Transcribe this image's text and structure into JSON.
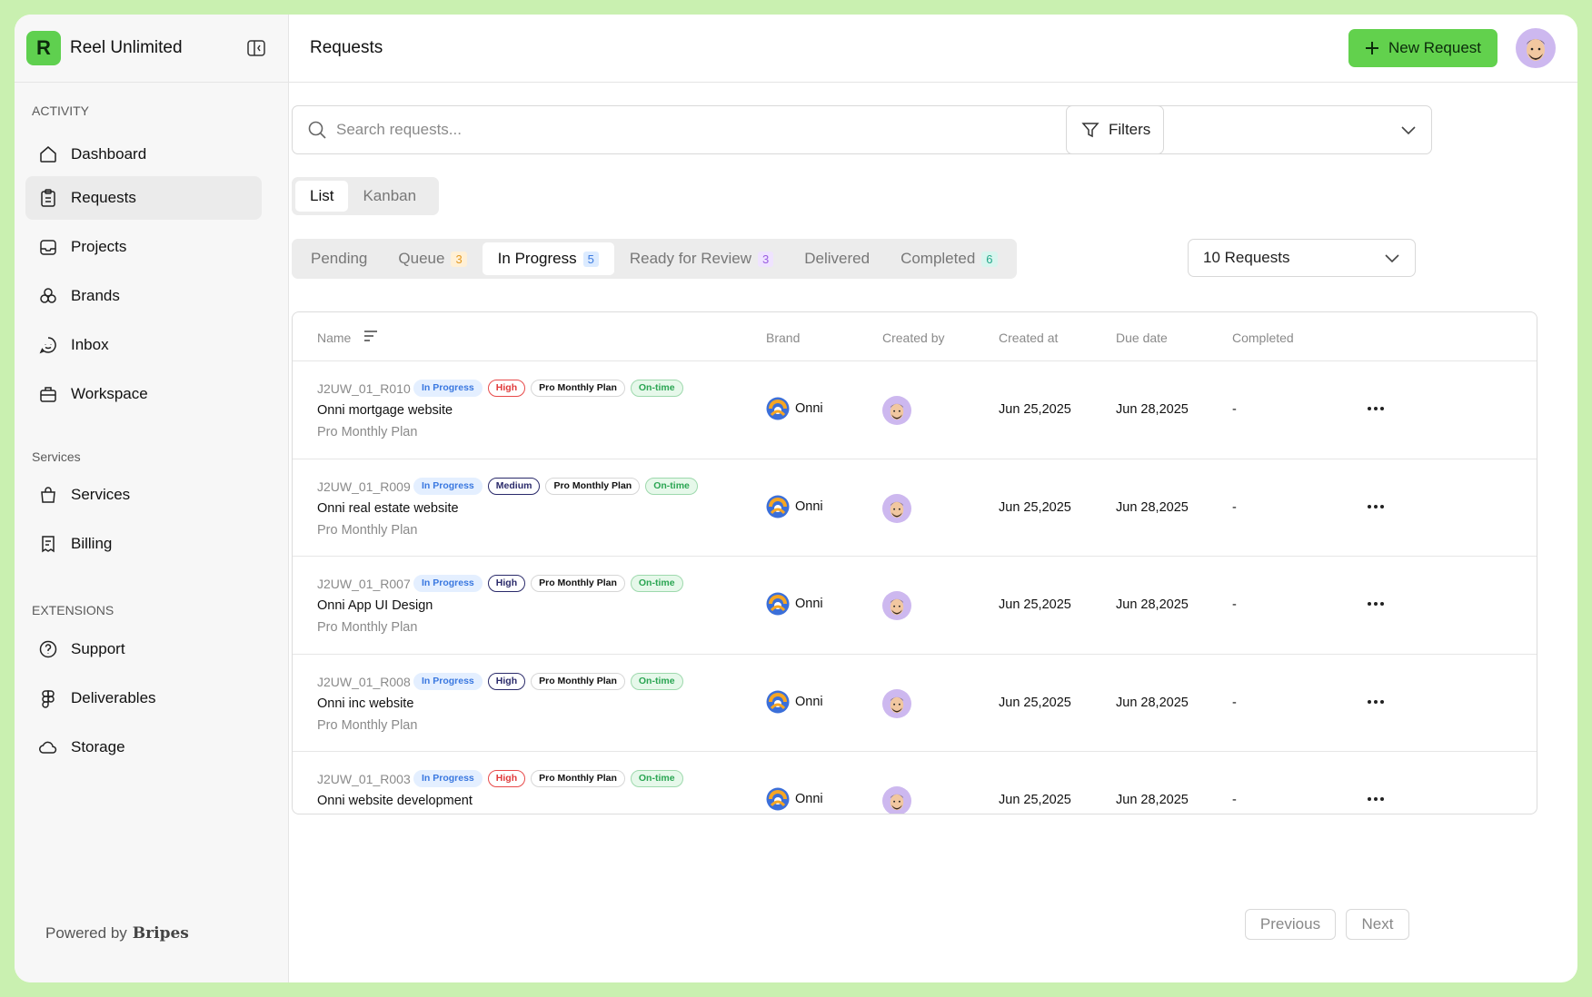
{
  "app": {
    "name": "Reel Unlimited",
    "logo_letter": "R",
    "accent": "#62d14d"
  },
  "sidebar": {
    "sections": [
      {
        "label": "ACTIVITY"
      },
      {
        "label": "Services"
      },
      {
        "label": "EXTENSIONS"
      }
    ],
    "items": [
      {
        "label": "Dashboard",
        "icon": "home-icon"
      },
      {
        "label": "Requests",
        "icon": "clipboard-icon",
        "active": true
      },
      {
        "label": "Projects",
        "icon": "inbox-tray-icon"
      },
      {
        "label": "Brands",
        "icon": "brands-icon"
      },
      {
        "label": "Inbox",
        "icon": "chat-icon"
      },
      {
        "label": "Workspace",
        "icon": "briefcase-icon"
      },
      {
        "label": "Services",
        "icon": "shopping-bag-icon"
      },
      {
        "label": "Billing",
        "icon": "receipt-icon"
      },
      {
        "label": "Support",
        "icon": "help-circle-icon"
      },
      {
        "label": "Deliverables",
        "icon": "figma-icon"
      },
      {
        "label": "Storage",
        "icon": "cloud-icon"
      }
    ],
    "powered_by": "Powered by",
    "powered_brand": "Bripes"
  },
  "header": {
    "title": "Requests",
    "new_button": "New Request"
  },
  "search": {
    "placeholder": "Search requests..."
  },
  "filters": {
    "label": "Filters"
  },
  "view_toggle": [
    "List",
    "Kanban"
  ],
  "status_tabs": [
    {
      "label": "Pending",
      "count": null
    },
    {
      "label": "Queue",
      "count": "3",
      "color": "orange"
    },
    {
      "label": "In Progress",
      "count": "5",
      "color": "blue",
      "active": true
    },
    {
      "label": "Ready for Review",
      "count": "3",
      "color": "purple"
    },
    {
      "label": "Delivered",
      "count": null
    },
    {
      "label": "Completed",
      "count": "6",
      "color": "teal"
    }
  ],
  "page_size": {
    "value": "10 Requests"
  },
  "table": {
    "columns": [
      "Name",
      "Brand",
      "Created by",
      "Created at",
      "Due date",
      "Completed"
    ],
    "rows": [
      {
        "id": "J2UW_01_R010",
        "status": "In Progress",
        "priority": "High",
        "priority_style": "red",
        "plan_badge": "Pro Monthly Plan",
        "timing": "On-time",
        "name": "Onni mortgage website",
        "plan": "Pro Monthly Plan",
        "brand": "Onni",
        "created_at": "Jun 25,2025",
        "due_date": "Jun 28,2025",
        "completed": "-"
      },
      {
        "id": "J2UW_01_R009",
        "status": "In Progress",
        "priority": "Medium",
        "priority_style": "navy",
        "plan_badge": "Pro Monthly Plan",
        "timing": "On-time",
        "name": "Onni real estate website",
        "plan": "Pro Monthly Plan",
        "brand": "Onni",
        "created_at": "Jun 25,2025",
        "due_date": "Jun 28,2025",
        "completed": "-"
      },
      {
        "id": "J2UW_01_R007",
        "status": "In Progress",
        "priority": "High",
        "priority_style": "navy",
        "plan_badge": "Pro Monthly Plan",
        "timing": "On-time",
        "name": "Onni App UI Design",
        "plan": "Pro Monthly Plan",
        "brand": "Onni",
        "created_at": "Jun 25,2025",
        "due_date": "Jun 28,2025",
        "completed": "-"
      },
      {
        "id": "J2UW_01_R008",
        "status": "In Progress",
        "priority": "High",
        "priority_style": "navy",
        "plan_badge": "Pro Monthly Plan",
        "timing": "On-time",
        "name": "Onni inc website",
        "plan": "Pro Monthly Plan",
        "brand": "Onni",
        "created_at": "Jun 25,2025",
        "due_date": "Jun 28,2025",
        "completed": "-"
      },
      {
        "id": "J2UW_01_R003",
        "status": "In Progress",
        "priority": "High",
        "priority_style": "red",
        "plan_badge": "Pro Monthly Plan",
        "timing": "On-time",
        "name": "Onni website development",
        "plan": "Pro Monthly Plan",
        "brand": "Onni",
        "created_at": "Jun 25,2025",
        "due_date": "Jun 28,2025",
        "completed": "-"
      }
    ]
  },
  "pagination": {
    "previous": "Previous",
    "next": "Next"
  }
}
